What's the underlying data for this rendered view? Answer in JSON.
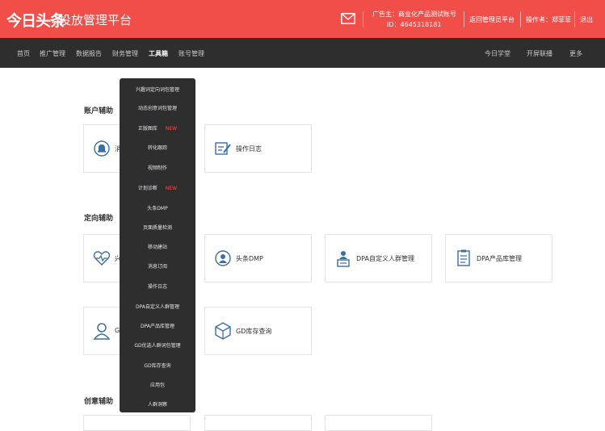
{
  "header": {
    "logo": "今日头条",
    "subtitle": "投放管理平台",
    "advertiser_line1": "广告主：商业化产品测试账号",
    "advertiser_line2": "ID：4645318181",
    "back_link": "返回管理员平台",
    "operator": "操作者：郑菲菲",
    "logout": "退出"
  },
  "nav": {
    "left": [
      "首页",
      "推广管理",
      "数据报告",
      "财务管理",
      "工具箱",
      "账号管理"
    ],
    "right": [
      "今日学堂",
      "开屏联播",
      "更多"
    ],
    "active_index": 4
  },
  "dropdown": {
    "new_badge": "NEW",
    "items": [
      {
        "label": "兴趣词定向词包管理",
        "new": false
      },
      {
        "label": "动态创意词包管理",
        "new": false
      },
      {
        "label": "正版图库",
        "new": true
      },
      {
        "label": "转化跟踪",
        "new": false
      },
      {
        "label": "视频制作",
        "new": false
      },
      {
        "label": "计划诊断",
        "new": true
      },
      {
        "label": "头条DMP",
        "new": false
      },
      {
        "label": "页面质量检测",
        "new": false
      },
      {
        "label": "移动建站",
        "new": false
      },
      {
        "label": "消息订阅",
        "new": false
      },
      {
        "label": "操作日志",
        "new": false
      },
      {
        "label": "DPA自定义人群管理",
        "new": false
      },
      {
        "label": "DPA产品库管理",
        "new": false
      },
      {
        "label": "GD优选人群词包管理",
        "new": false
      },
      {
        "label": "GD库存查询",
        "new": false
      },
      {
        "label": "应用包",
        "new": false
      },
      {
        "label": "人群洞察",
        "new": false
      }
    ]
  },
  "sections": {
    "account": "账户辅助",
    "targeting": "定向辅助",
    "creative": "创意辅助"
  },
  "cards": {
    "account_1": "消",
    "account_2": "操作日志",
    "targeting_1": "兴",
    "targeting_2": "头条DMP",
    "targeting_3": "DPA自定义人群管理",
    "targeting_4": "DPA产品库管理",
    "gd_1": "G",
    "gd_2": "GD库存查询"
  },
  "colors": {
    "brand_red": "#f14d49",
    "nav_dark": "#2e2e2e",
    "icon_blue": "#3a6ea5"
  }
}
